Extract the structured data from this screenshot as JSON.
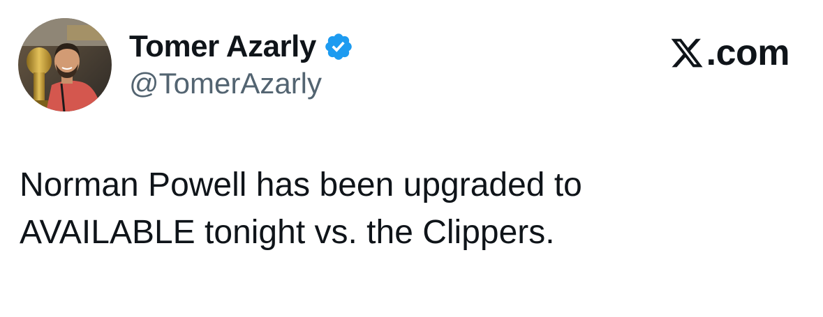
{
  "author": {
    "display_name": "Tomer Azarly",
    "handle": "@TomerAzarly",
    "verified": true,
    "avatar_icon": "profile-photo"
  },
  "brand": {
    "icon": "x-logo-icon",
    "text": ".com"
  },
  "tweet": {
    "lines": [
      "Norman Powell has been upgraded to",
      "AVAILABLE tonight vs. the Clippers."
    ]
  },
  "colors": {
    "text": "#0f1419",
    "secondary_text": "#536471",
    "verified_badge": "#1d9bf0",
    "background": "#ffffff"
  }
}
